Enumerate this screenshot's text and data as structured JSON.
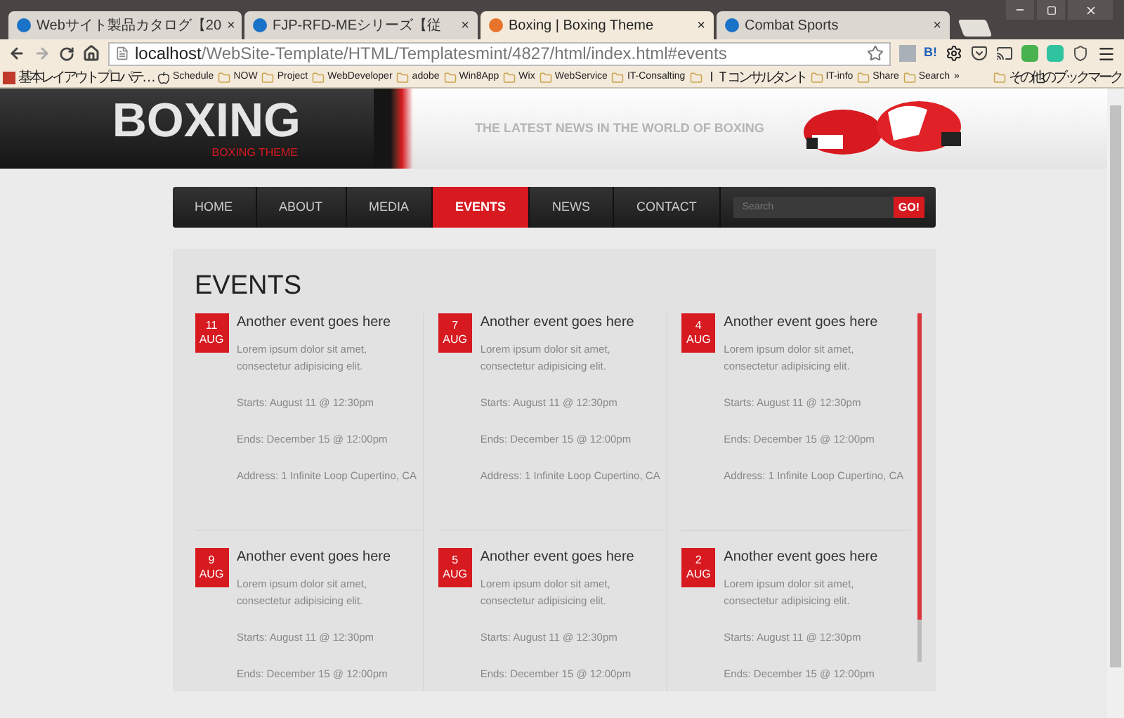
{
  "browser": {
    "tabs": [
      {
        "title": "Webサイト製品カタログ【20",
        "selected": false,
        "close": "×"
      },
      {
        "title": "FJP-RFD-MEシリーズ【従",
        "selected": false,
        "close": "×"
      },
      {
        "title": "Boxing | Boxing Theme",
        "selected": true,
        "close": "×"
      },
      {
        "title": "Combat Sports",
        "selected": false,
        "close": "×"
      }
    ],
    "address": {
      "host": "localhost",
      "path": "/WebSite-Template/HTML/Templatesmint/4827/html/index.html#events"
    },
    "extensions": [
      "B!"
    ],
    "bookmarks": [
      {
        "label": "基本レイアウトプロパテ…",
        "kind": "page"
      },
      {
        "label": "Schedule",
        "kind": "page"
      },
      {
        "label": "NOW",
        "kind": "folder"
      },
      {
        "label": "Project",
        "kind": "folder"
      },
      {
        "label": "WebDeveloper",
        "kind": "folder"
      },
      {
        "label": "adobe",
        "kind": "folder"
      },
      {
        "label": "Win8App",
        "kind": "folder"
      },
      {
        "label": "Wix",
        "kind": "folder"
      },
      {
        "label": "WebService",
        "kind": "folder"
      },
      {
        "label": "IT-Consalting",
        "kind": "folder"
      },
      {
        "label": "ＩＴコンサルタント",
        "kind": "folder"
      },
      {
        "label": "IT-info",
        "kind": "folder"
      },
      {
        "label": "Share",
        "kind": "folder"
      },
      {
        "label": "Search",
        "kind": "folder"
      }
    ],
    "more": "»",
    "other_bookmarks": "その他のブックマーク"
  },
  "header": {
    "logo": "BOXING",
    "logo_sub": "BOXING THEME",
    "tagline": "THE LATEST NEWS IN THE WORLD OF BOXING"
  },
  "nav": {
    "items": [
      {
        "label": "HOME",
        "selected": false
      },
      {
        "label": "ABOUT",
        "selected": false
      },
      {
        "label": "MEDIA",
        "selected": false
      },
      {
        "label": "EVENTS",
        "selected": true
      },
      {
        "label": "NEWS",
        "selected": false
      },
      {
        "label": "CONTACT",
        "selected": false
      }
    ],
    "search": {
      "placeholder": "Search",
      "button": "GO!"
    }
  },
  "events": {
    "title": "EVENTS",
    "items": [
      {
        "day": "11",
        "month": "AUG",
        "title": "Another event goes here",
        "text": "Lorem ipsum dolor sit amet, consectetur adipisicing elit.",
        "starts": "Starts: August 11 @ 12:30pm",
        "ends": "Ends: December 15 @ 12:00pm",
        "address": "Address: 1 Infinite Loop Cupertino, CA"
      },
      {
        "day": "7",
        "month": "AUG",
        "title": "Another event goes here",
        "text": "Lorem ipsum dolor sit amet, consectetur adipisicing elit.",
        "starts": "Starts: August 11 @ 12:30pm",
        "ends": "Ends: December 15 @ 12:00pm",
        "address": "Address: 1 Infinite Loop Cupertino, CA"
      },
      {
        "day": "4",
        "month": "AUG",
        "title": "Another event goes here",
        "text": "Lorem ipsum dolor sit amet, consectetur adipisicing elit.",
        "starts": "Starts: August 11 @ 12:30pm",
        "ends": "Ends: December 15 @ 12:00pm",
        "address": "Address: 1 Infinite Loop Cupertino, CA"
      },
      {
        "day": "9",
        "month": "AUG",
        "title": "Another event goes here",
        "text": "Lorem ipsum dolor sit amet, consectetur adipisicing elit.",
        "starts": "Starts: August 11 @ 12:30pm",
        "ends": "Ends: December 15 @ 12:00pm"
      },
      {
        "day": "5",
        "month": "AUG",
        "title": "Another event goes here",
        "text": "Lorem ipsum dolor sit amet, consectetur adipisicing elit.",
        "starts": "Starts: August 11 @ 12:30pm",
        "ends": "Ends: December 15 @ 12:00pm"
      },
      {
        "day": "2",
        "month": "AUG",
        "title": "Another event goes here",
        "text": "Lorem ipsum dolor sit amet, consectetur adipisicing elit.",
        "starts": "Starts: August 11 @ 12:30pm",
        "ends": "Ends: December 15 @ 12:00pm"
      }
    ]
  }
}
